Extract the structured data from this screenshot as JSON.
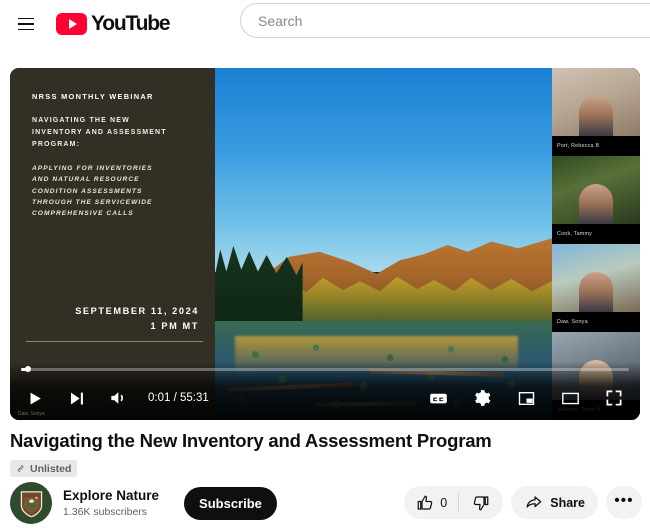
{
  "header": {
    "menu_icon": "hamburger-menu-icon",
    "logo_text": "YouTube",
    "search_placeholder": "Search",
    "search_value": ""
  },
  "player": {
    "slide": {
      "kicker": "NRSS MONTHLY WEBINAR",
      "headline": "NAVIGATING THE NEW\nINVENTORY AND ASSESSMENT\nPROGRAM:",
      "subline": "APPLYING FOR INVENTORIES\nAND NATURAL RESOURCE\nCONDITION ASSESSMENTS\nTHROUGH THE SERVICEWIDE\nCOMPREHENSIVE CALLS",
      "date": "SEPTEMBER 11, 2024",
      "time": "1 PM MT",
      "watermark": "Daw, Sonya"
    },
    "participants": [
      {
        "name": "Port, Rebecca B"
      },
      {
        "name": "Cook, Tammy"
      },
      {
        "name": "Daw, Sonya"
      },
      {
        "name": "Valerius, Tracy A"
      }
    ],
    "controls": {
      "play_label": "Play",
      "next_label": "Next",
      "volume_label": "Mute",
      "time_display": "0:01 / 55:31",
      "current_time": "0:01",
      "duration": "55:31",
      "progress_percent": 1,
      "subtitles_label": "Subtitles/closed captions",
      "settings_label": "Settings",
      "miniplayer_label": "Miniplayer",
      "theater_label": "Theater mode",
      "fullscreen_label": "Full screen"
    }
  },
  "video": {
    "title": "Navigating the New Inventory and Assessment Program",
    "privacy_badge": "Unlisted"
  },
  "channel": {
    "name": "Explore Nature",
    "subscribers": "1.36K subscribers",
    "subscribe_label": "Subscribe",
    "avatar_alt": "nps-arrowhead-logo"
  },
  "actions": {
    "like_count": "0",
    "share_label": "Share",
    "more_label": "•••"
  },
  "colors": {
    "brand_red": "#ff0033",
    "text_primary": "#0f0f0f",
    "text_secondary": "#606060",
    "pill_bg": "#f2f2f2"
  }
}
